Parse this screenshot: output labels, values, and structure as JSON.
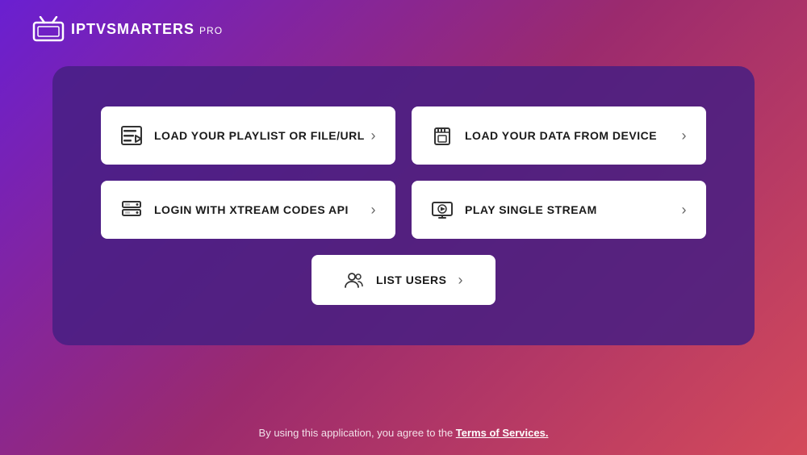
{
  "header": {
    "logo_iptv": "IPTV",
    "logo_smarters": "SMARTERS",
    "logo_pro": "PRO"
  },
  "card": {
    "buttons": [
      {
        "id": "load-playlist",
        "label": "LOAD YOUR PLAYLIST OR FILE/URL",
        "icon": "playlist-icon"
      },
      {
        "id": "load-device",
        "label": "LOAD YOUR DATA FROM DEVICE",
        "icon": "device-icon"
      },
      {
        "id": "xtream-login",
        "label": "LOGIN WITH XTREAM CODES API",
        "icon": "xtream-icon"
      },
      {
        "id": "play-stream",
        "label": "PLAY SINGLE STREAM",
        "icon": "stream-icon"
      }
    ],
    "list_users_label": "LIST USERS"
  },
  "footer": {
    "text": "By using this application, you agree to the ",
    "link_text": "Terms of Services."
  }
}
